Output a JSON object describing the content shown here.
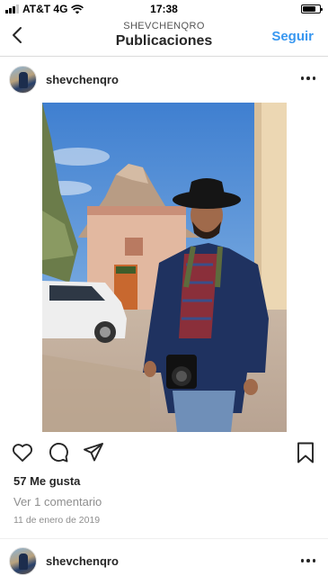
{
  "status_bar": {
    "carrier": "AT&T 4G",
    "time": "17:38",
    "battery_level": 0.75
  },
  "nav": {
    "subtitle": "SHEVCHENQRO",
    "title": "Publicaciones",
    "follow_label": "Seguir",
    "back_icon": "chevron-left-icon"
  },
  "post": {
    "username": "shevchenqro",
    "likes": "57 Me gusta",
    "comments_link": "Ver 1 comentario",
    "date": "11 de enero de 2019",
    "icons": {
      "like": "heart-icon",
      "comment": "speech-bubble-icon",
      "share": "paper-plane-icon",
      "save": "bookmark-icon",
      "more": "more-dots-icon"
    }
  },
  "next_post": {
    "username": "shevchenqro"
  },
  "colors": {
    "accent": "#3897f0",
    "text": "#262626",
    "muted": "#8e8e8e",
    "divider": "#dbdbdb"
  }
}
